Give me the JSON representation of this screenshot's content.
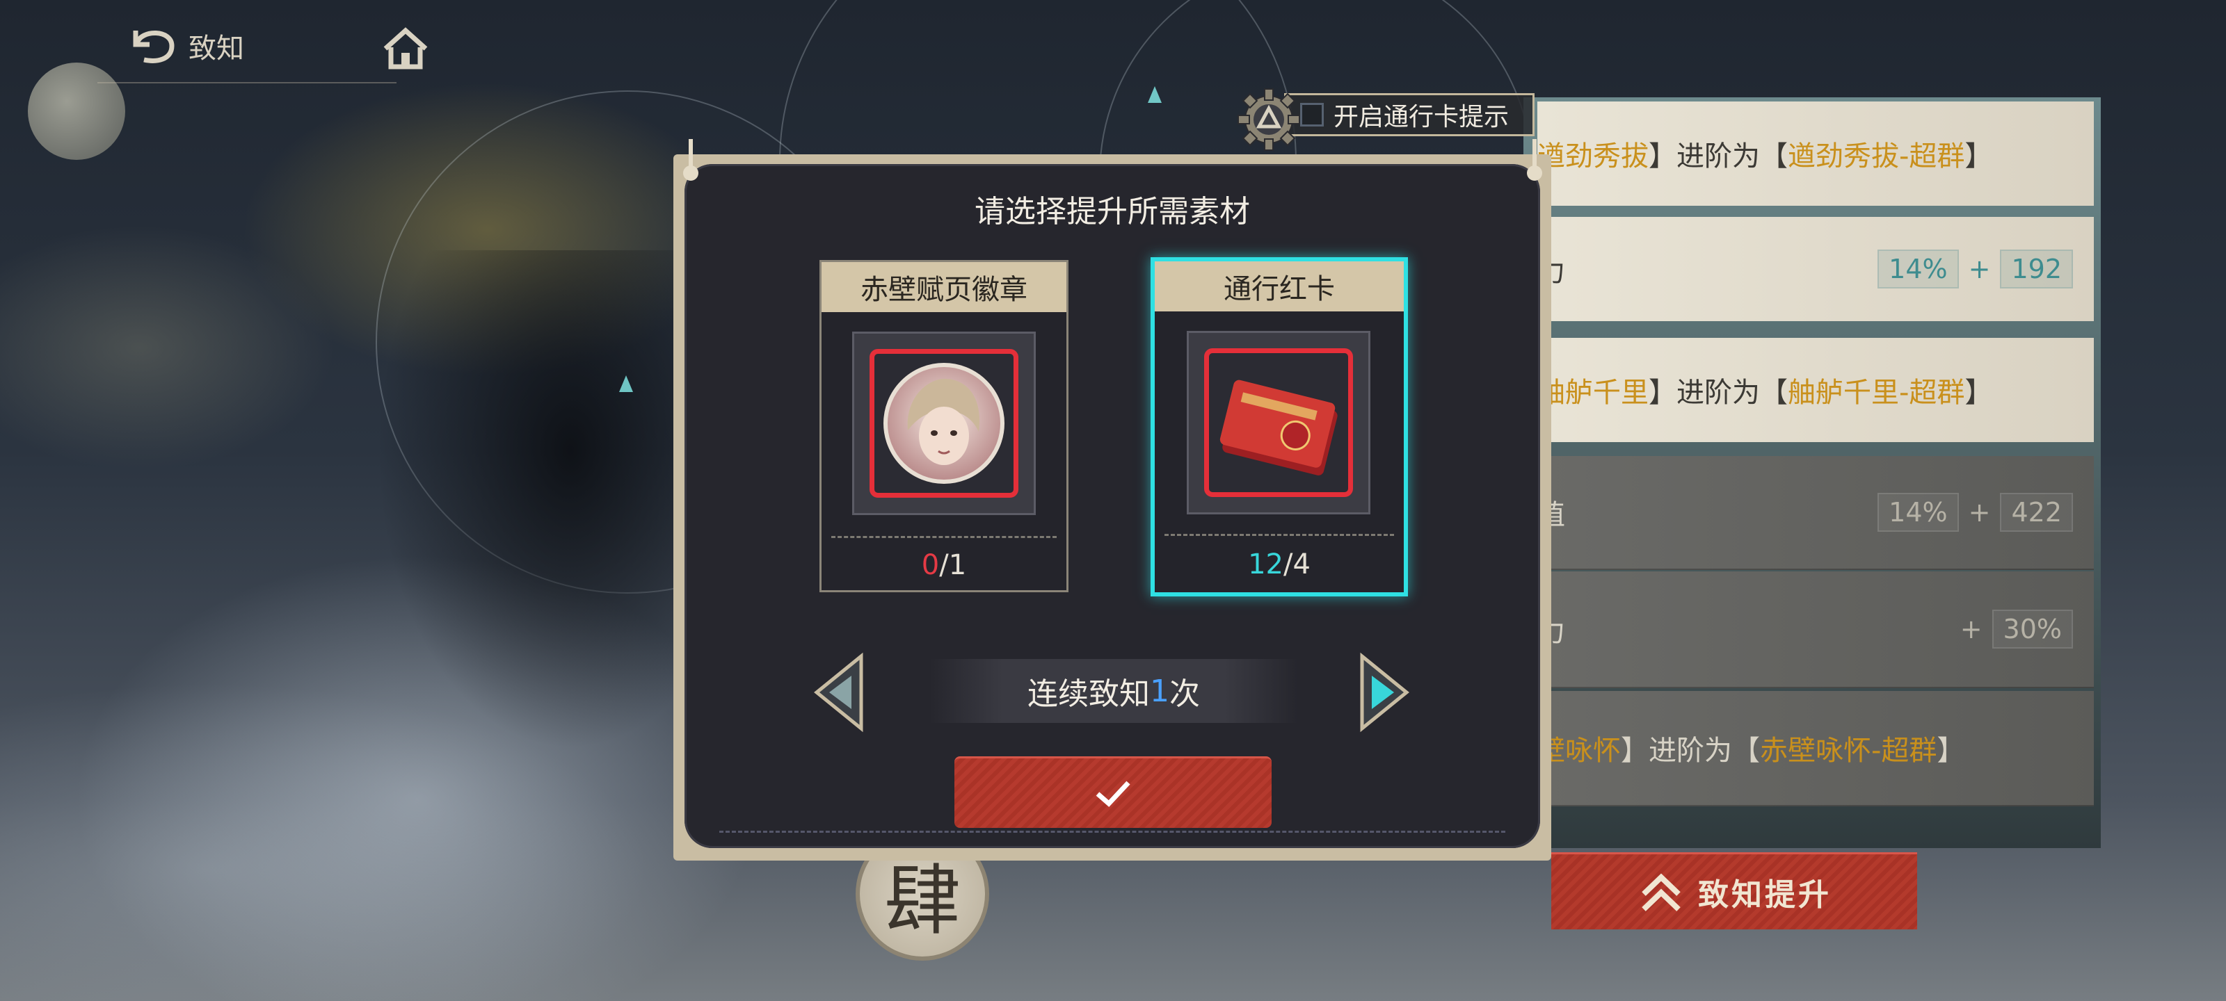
{
  "nav": {
    "back_label": "致知"
  },
  "hint": {
    "label": "开启通行卡提示",
    "checked": false
  },
  "modal": {
    "title": "请选择提升所需素材",
    "materials": [
      {
        "name": "赤壁赋页徽章",
        "owned": "0",
        "required": "1",
        "selected": false
      },
      {
        "name": "通行红卡",
        "owned": "12",
        "required": "4",
        "selected": true
      }
    ],
    "loop_prefix": "连续致知",
    "loop_count": "1",
    "loop_suffix": "次"
  },
  "right_panel": {
    "rows": [
      {
        "pre": "遒劲秀拔",
        "mid": "】进阶为【",
        "post": "遒劲秀拔-超群",
        "tail": "】"
      },
      {
        "label": "力",
        "percent": "14%",
        "plus": "+",
        "value": "192"
      },
      {
        "pre": "舳舻千里",
        "mid": "】进阶为【",
        "post": "舳舻千里-超群",
        "tail": "】"
      },
      {
        "label": "值",
        "percent": "14%",
        "plus": "+",
        "value": "422"
      },
      {
        "label": "力",
        "plus": "+",
        "value": "30%"
      },
      {
        "pre": "壁咏怀",
        "mid": "】进阶为【",
        "post": "赤壁咏怀-超群",
        "tail": "】"
      }
    ]
  },
  "upgrade_button": {
    "label": "致知提升"
  },
  "seal": {
    "char": "肆"
  },
  "colors": {
    "accent_cyan": "#2fe0e3",
    "button_red": "#b43a2c",
    "deficit_red": "#e53a45",
    "gold_text": "#c9901c"
  }
}
